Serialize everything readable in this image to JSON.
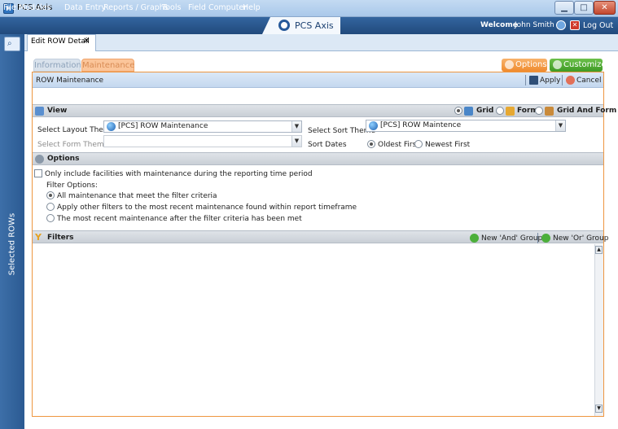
{
  "window": {
    "title": "PCS Axis",
    "app_icon_letter": "H"
  },
  "menu": {
    "items": [
      "File",
      "Modules",
      "Data Entry",
      "Reports / Graphs",
      "Tools",
      "Field Computer",
      "Help"
    ],
    "logo_text": "PCS Axis",
    "welcome_label": "Welcome",
    "user_name": "John Smith",
    "logout_label": "Log Out"
  },
  "sidebar": {
    "label": "Selected ROWs"
  },
  "doc_tab": {
    "label": "Edit ROW Detail",
    "close_glyph": "✕"
  },
  "subtabs": {
    "information": "Information",
    "maintenance": "Maintenance"
  },
  "toolbar": {
    "options_label": "Options",
    "customize_label": "Customize"
  },
  "row_panel": {
    "title": "ROW Maintenance",
    "apply_label": "Apply",
    "cancel_label": "Cancel"
  },
  "view": {
    "title": "View",
    "modes": [
      {
        "label": "Grid",
        "selected": true
      },
      {
        "label": "Form",
        "selected": false
      },
      {
        "label": "Grid And Form",
        "selected": false
      }
    ],
    "layout_theme_label": "Select Layout Theme",
    "layout_theme_value": "[PCS] ROW Maintenance",
    "form_theme_label": "Select Form Theme",
    "form_theme_value": "",
    "sort_theme_label": "Select Sort Theme",
    "sort_theme_value": "[PCS] ROW Maintence",
    "sort_dates_label": "Sort Dates",
    "sort_dates_options": [
      {
        "label": "Oldest First",
        "selected": true
      },
      {
        "label": "Newest First",
        "selected": false
      }
    ]
  },
  "options": {
    "title": "Options",
    "only_include_label": "Only include facilities with maintenance during the reporting time period",
    "only_include_checked": false,
    "filter_options_label": "Filter Options:",
    "filter_options": [
      {
        "label": "All maintenance that meet the filter criteria",
        "selected": true
      },
      {
        "label": "Apply other filters to the most recent maintenance found within report timeframe",
        "selected": false
      },
      {
        "label": "The most recent maintenance after the filter criteria has been met",
        "selected": false
      }
    ]
  },
  "filters": {
    "title": "Filters",
    "new_and_group": "New 'And' Group",
    "new_or_group": "New 'Or' Group"
  },
  "colors": {
    "accent_orange": "#ef8a2d",
    "accent_green": "#3e9a25",
    "menubar": "#21497c"
  }
}
